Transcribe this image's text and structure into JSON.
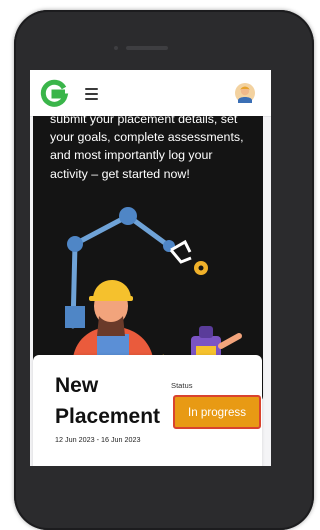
{
  "header": {
    "logo_icon": "g-logo-icon",
    "menu_icon": "hamburger-menu-icon",
    "avatar_icon": "user-avatar-icon"
  },
  "hero": {
    "intro_lines": [
      "submit your placement details, set",
      "your goals, complete assessments,",
      "and most importantly log your",
      "activity – get started now!"
    ],
    "illustration": "worker-with-robot-illustration"
  },
  "placement": {
    "title_line1": "New",
    "title_line2": "Placement",
    "dates": "12 Jun 2023 - 16 Jun 2023",
    "status_label": "Status",
    "status_value": "In progress"
  },
  "colors": {
    "brand_green": "#3ab54a",
    "hero_bg": "#141414",
    "status_badge": "#e89a14",
    "status_border": "#d9432e"
  }
}
